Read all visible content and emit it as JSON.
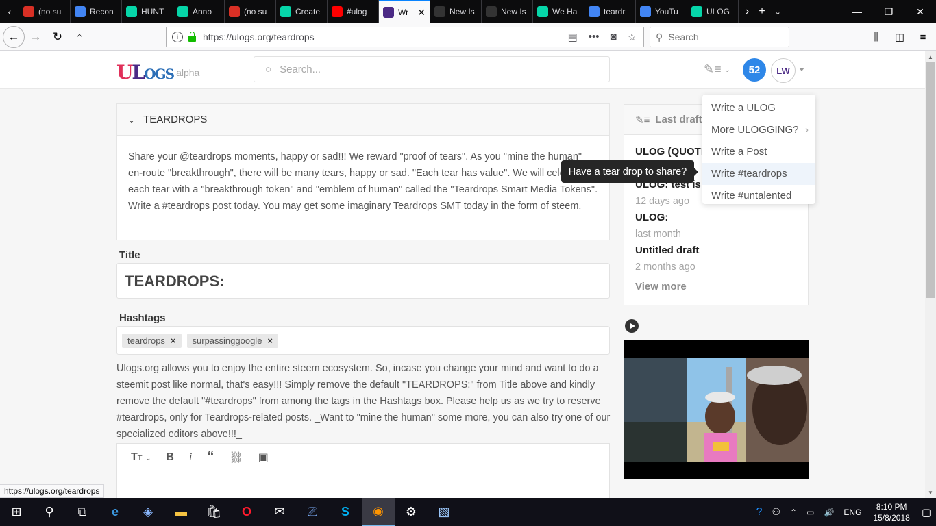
{
  "browser": {
    "tabs": [
      {
        "label": "(no su",
        "icon": "gmail-icon",
        "color": "#d93025"
      },
      {
        "label": "Recon",
        "icon": "google-icon",
        "color": "#4285f4"
      },
      {
        "label": "HUNT",
        "icon": "steem-icon",
        "color": "#06d6a9"
      },
      {
        "label": "Anno",
        "icon": "steem-icon",
        "color": "#06d6a9"
      },
      {
        "label": "(no su",
        "icon": "gmail-icon",
        "color": "#d93025"
      },
      {
        "label": "Create",
        "icon": "steem-icon",
        "color": "#06d6a9"
      },
      {
        "label": "#ulog",
        "icon": "youtube-icon",
        "color": "#ff0000"
      },
      {
        "label": "Wr",
        "icon": "ulogs-icon",
        "color": "#4b2a85",
        "active": true
      },
      {
        "label": "New Is",
        "icon": "github-icon",
        "color": "#333333"
      },
      {
        "label": "New Is",
        "icon": "github-icon",
        "color": "#333333"
      },
      {
        "label": "We Ha",
        "icon": "steem-icon",
        "color": "#06d6a9"
      },
      {
        "label": "teardr",
        "icon": "google-icon",
        "color": "#4285f4"
      },
      {
        "label": "YouTu",
        "icon": "google-icon",
        "color": "#4285f4"
      },
      {
        "label": "ULOG",
        "icon": "steem-icon",
        "color": "#06d6a9"
      }
    ],
    "url": "https://ulogs.org/teardrops",
    "search_placeholder": "Search",
    "status_url": "https://ulogs.org/teardrops"
  },
  "site": {
    "logo_text": "ULOGS",
    "logo_tag": "alpha",
    "search_placeholder": "Search...",
    "notifications_count": "52",
    "avatar_text": "LW",
    "accent_color": "#2e87e8"
  },
  "tag_card": {
    "heading": "TEARDROPS",
    "description": "Share your @teardrops moments, happy or sad!!! We reward \"proof of tears\". As you \"mine the human\" en-route \"breakthrough\", there will be many tears, happy or sad. \"Each tear has value\". We will celebrate each tear with a \"breakthrough token\" and \"emblem of human\" called the \"Teardrops Smart Media Tokens\". Write a #teardrops post today. You may get some imaginary Teardrops SMT today in the form of steem."
  },
  "form": {
    "title_label": "Title",
    "title_value": "TEARDROPS:",
    "hashtags_label": "Hashtags",
    "tags": [
      "teardrops",
      "surpassinggoogle"
    ],
    "tag_remove": "×",
    "notice": "Ulogs.org allows you to enjoy the entire steem ecosystem. So, incase you change your mind and want to do a steemit post like normal, that's easy!!! Simply remove the default \"TEARDROPS:\" from Title above and kindly remove the default \"#teardrops\" from among the tags in the Hashtags box. Please help us as we try to reserve #teardrops, only for Teardrops-related posts. _Want to \"mine the human\" some more, you can also try one of our specialized editors above!!!_"
  },
  "editor": {
    "tools": [
      {
        "name": "heading-icon",
        "glyph": "TT"
      },
      {
        "name": "bold-icon",
        "glyph": "B"
      },
      {
        "name": "italic-icon",
        "glyph": "i"
      },
      {
        "name": "quote-icon",
        "glyph": "❝"
      },
      {
        "name": "link-icon",
        "glyph": "🔗"
      },
      {
        "name": "image-icon",
        "glyph": "▣"
      }
    ]
  },
  "drafts": {
    "heading": "Last drafts",
    "items": [
      {
        "title": "ULOG (QUOTE",
        "time": ""
      },
      {
        "title": "ULOG: test is h",
        "time": "12 days ago"
      },
      {
        "title": "ULOG:",
        "time": "last month"
      },
      {
        "title": "Untitled draft",
        "time": "2 months ago"
      }
    ],
    "view_more": "View more"
  },
  "dropdown": {
    "items": [
      "Write a ULOG",
      "More ULOGGING?",
      "Write a Post",
      "Write #teardrops",
      "Write #untalented"
    ],
    "tooltip": "Have a tear drop to share?"
  },
  "taskbar": {
    "language": "ENG",
    "time": "8:10 PM",
    "date": "15/8/2018"
  }
}
